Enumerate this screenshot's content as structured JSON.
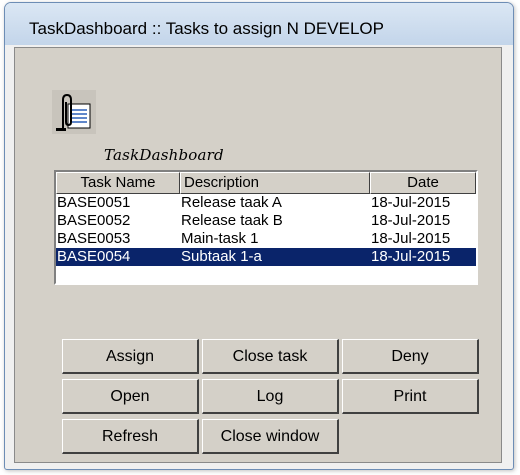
{
  "window": {
    "title": "TaskDashboard :: Tasks to assign N DEVELOP"
  },
  "logo": {
    "icon": "paperclip-document-icon",
    "text": "TaskDashboard"
  },
  "tasks": {
    "columns": [
      "Task Name",
      "Description",
      "Date"
    ],
    "rows": [
      {
        "name": "BASE0051",
        "description": "Release taak A",
        "date": "18-Jul-2015",
        "selected": false
      },
      {
        "name": "BASE0052",
        "description": "Release taak B",
        "date": "18-Jul-2015",
        "selected": false
      },
      {
        "name": "BASE0053",
        "description": "Main-task 1",
        "date": "18-Jul-2015",
        "selected": false
      },
      {
        "name": "BASE0054",
        "description": "Subtaak 1-a",
        "date": "18-Jul-2015",
        "selected": true
      }
    ]
  },
  "buttons": {
    "assign": "Assign",
    "close_task": "Close task",
    "deny": "Deny",
    "open": "Open",
    "log": "Log",
    "print": "Print",
    "refresh": "Refresh",
    "close_window": "Close window"
  },
  "colors": {
    "selection": "#0a246a",
    "face": "#d4d0c8",
    "titlebar": "#c3d5ea"
  }
}
